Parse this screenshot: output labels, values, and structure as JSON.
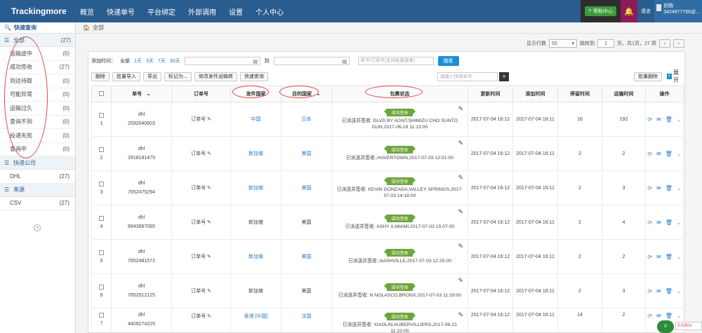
{
  "brand": "Trackingmore",
  "nav": [
    "概览",
    "快递单号",
    "平台绑定",
    "外部调用",
    "设置",
    "个人中心"
  ],
  "topright": {
    "help": "帮助中心",
    "lang": "语言",
    "user_line1": "创始",
    "user_line2": "3424977756@..."
  },
  "sidebar": {
    "search_label": "快速查询",
    "group_all": {
      "label": "全部",
      "count": "(27)"
    },
    "status_items": [
      {
        "label": "运输途中",
        "count": "(0)"
      },
      {
        "label": "成功签收",
        "count": "(27)"
      },
      {
        "label": "到达待取",
        "count": "(0)"
      },
      {
        "label": "可能异常",
        "count": "(0)"
      },
      {
        "label": "运输过久",
        "count": "(0)"
      },
      {
        "label": "查询不到",
        "count": "(0)"
      },
      {
        "label": "投递失败",
        "count": "(0)"
      },
      {
        "label": "查询中",
        "count": "(0)"
      }
    ],
    "carrier_header": "快递公司",
    "carrier_items": [
      {
        "label": "DHL",
        "count": "(27)"
      }
    ],
    "source_header": "来源",
    "source_items": [
      {
        "label": "CSV",
        "count": "(27)"
      }
    ]
  },
  "breadcrumb": "全部",
  "pager": {
    "show_label": "显示行数",
    "show_value": "50",
    "jump_label": "跳转到",
    "page_value": "1",
    "summary": "页，共1页，27 项"
  },
  "filter": {
    "add_time_label": "添加时间：",
    "all": "全部",
    "ranges": [
      "1天",
      "3天",
      "7天",
      "30天"
    ],
    "to": "到",
    "search_placeholder": "单号/订单号(支持批量搜索)",
    "search_button": "搜索"
  },
  "actions": {
    "buttons": [
      "删除",
      "批量导入",
      "导出",
      "标记为...",
      "修改发件运输商",
      "快速查询"
    ],
    "quick_placeholder": "请输入快递单号",
    "add": "+",
    "bulk_delete": "批量删除",
    "expand": "展开"
  },
  "table": {
    "headers": [
      "单号",
      "订单号",
      "发件国家",
      "目的国家",
      "包裹状态",
      "更新时间",
      "添加时间",
      "停留时间",
      "运输时间",
      "操作"
    ],
    "order_placeholder": "订单号",
    "badge": "成功签收",
    "rows": [
      {
        "num": "1",
        "carrier": "dhl",
        "tracking": "2592040603",
        "origin": "中国",
        "dest": "日本",
        "status": "已派送并签收: DLVD BY AGNT,SHIMIZU CHO SUNTO GUN,2017-06-19 11:13:00",
        "update": "2017-07-04 16:12",
        "added": "2017-07-04 16:11",
        "stay": "16",
        "transit": "192"
      },
      {
        "num": "2",
        "carrier": "dhl",
        "tracking": "2918181475",
        "origin": "新加坡",
        "dest": "美国",
        "status": "已派送并签收:,HAVERTOWN,2017-07-03 12:51:00",
        "update": "2017-07-04 16:12",
        "added": "2017-07-04 16:11",
        "stay": "2",
        "transit": "2"
      },
      {
        "num": "3",
        "carrier": "dhl",
        "tracking": "7652475294",
        "origin": "新加坡",
        "dest": "美国",
        "status": "已派送并签收: KEVIN GONZAGA,VALLEY SPRINGS,2017-07-03 14:18:00",
        "update": "2017-07-04 16:12",
        "added": "2017-07-04 16:11",
        "stay": "2",
        "transit": "3"
      },
      {
        "num": "4",
        "carrier": "dhl",
        "tracking": "8943667095",
        "origin": "新加坡",
        "dest": "美国",
        "status": "已派送并签收: ASHY A,MIAMI,2017-07-03 15:07:00",
        "update": "2017-07-04 16:12",
        "added": "2017-07-04 16:11",
        "stay": "2",
        "transit": "4"
      },
      {
        "num": "5",
        "carrier": "dhl",
        "tracking": "7652481572",
        "origin": "新加坡",
        "dest": "美国",
        "status": "已派送并签收:,NASHVILLE,2017-07-03 12:25:00",
        "update": "2017-07-04 16:12",
        "added": "2017-07-04 16:11",
        "stay": "2",
        "transit": "2"
      },
      {
        "num": "6",
        "carrier": "dhl",
        "tracking": "7652512125",
        "origin": "新加坡",
        "dest": "美国",
        "status": "已派送并签收: N NOLASCO,BRONX,2017-07-03 11:29:00",
        "update": "2017-07-04 16:12",
        "added": "2017-07-04 16:11",
        "stay": "2",
        "transit": "3"
      },
      {
        "num": "7",
        "carrier": "dhl",
        "tracking": "4409274225",
        "origin": "香港 [中国]",
        "dest": "法国",
        "status": "已派送并签收: XIAOLIN,AUBERVILLIERS,2017-06-21 11:22:00",
        "update": "2017-07-04 16:12",
        "added": "2017-07-04 16:11",
        "stay": "14",
        "transit": "2"
      }
    ]
  },
  "watermark": {
    "brand": "Baidu经验",
    "url": "jingyan.baidu.com"
  },
  "speed": "0.02K/s"
}
